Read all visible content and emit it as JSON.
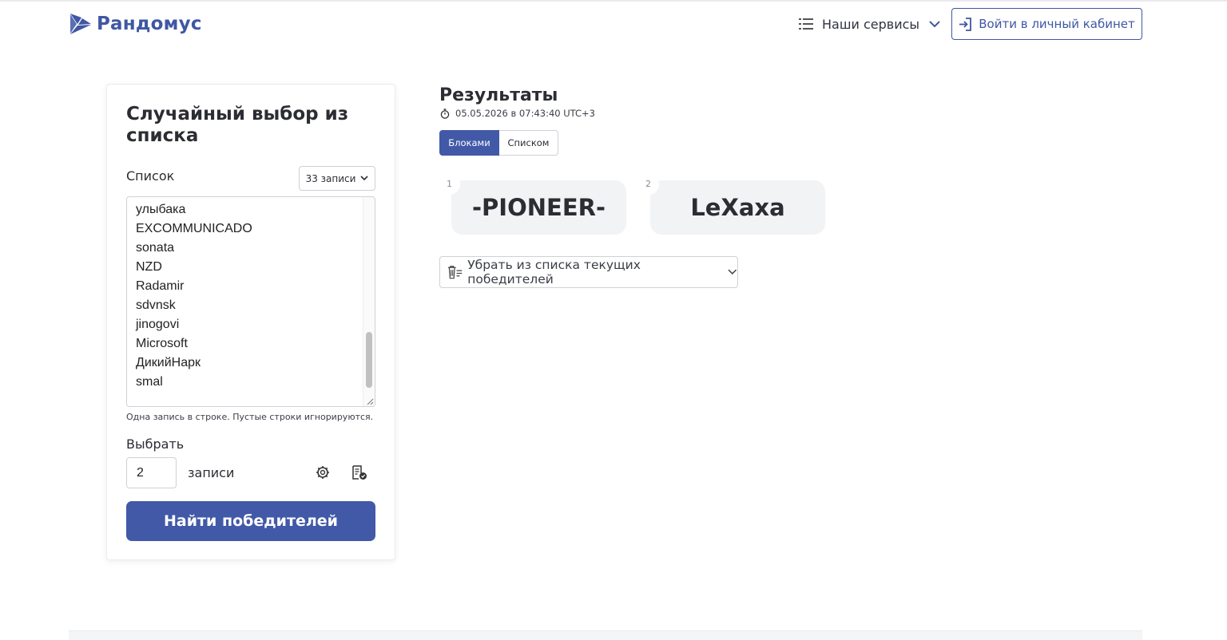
{
  "brand": {
    "name": "Рандомус",
    "color": "#3f57a4"
  },
  "header": {
    "services_label": "Наши сервисы",
    "login_label": "Войти в личный кабинет"
  },
  "form": {
    "title": "Случайный выбор из списка",
    "list_label": "Список",
    "count_label": "33 записи",
    "entries": [
      "улыбака",
      "EXCOMMUNICADO",
      "sonata",
      "NZD",
      "Radamir",
      "sdvnsk",
      "jinogovi",
      "Microsoft",
      "ДикийНарк",
      "smal"
    ],
    "hint": "Одна запись в строке. Пустые строки игнорируются.",
    "choose_label": "Выбрать",
    "quantity": "2",
    "quantity_unit": "записи",
    "find_button": "Найти победителей",
    "button_color": "#4259a8"
  },
  "results": {
    "title": "Результаты",
    "date": "05.05.2026 в 07:43:40 UTC+3",
    "view_blocks": "Блоками",
    "view_list": "Списком",
    "winners": [
      {
        "num": "1",
        "name": "-PIONEER-"
      },
      {
        "num": "2",
        "name": "LeXaxa"
      }
    ],
    "remove_label": "Убрать из списка текущих победителей"
  }
}
